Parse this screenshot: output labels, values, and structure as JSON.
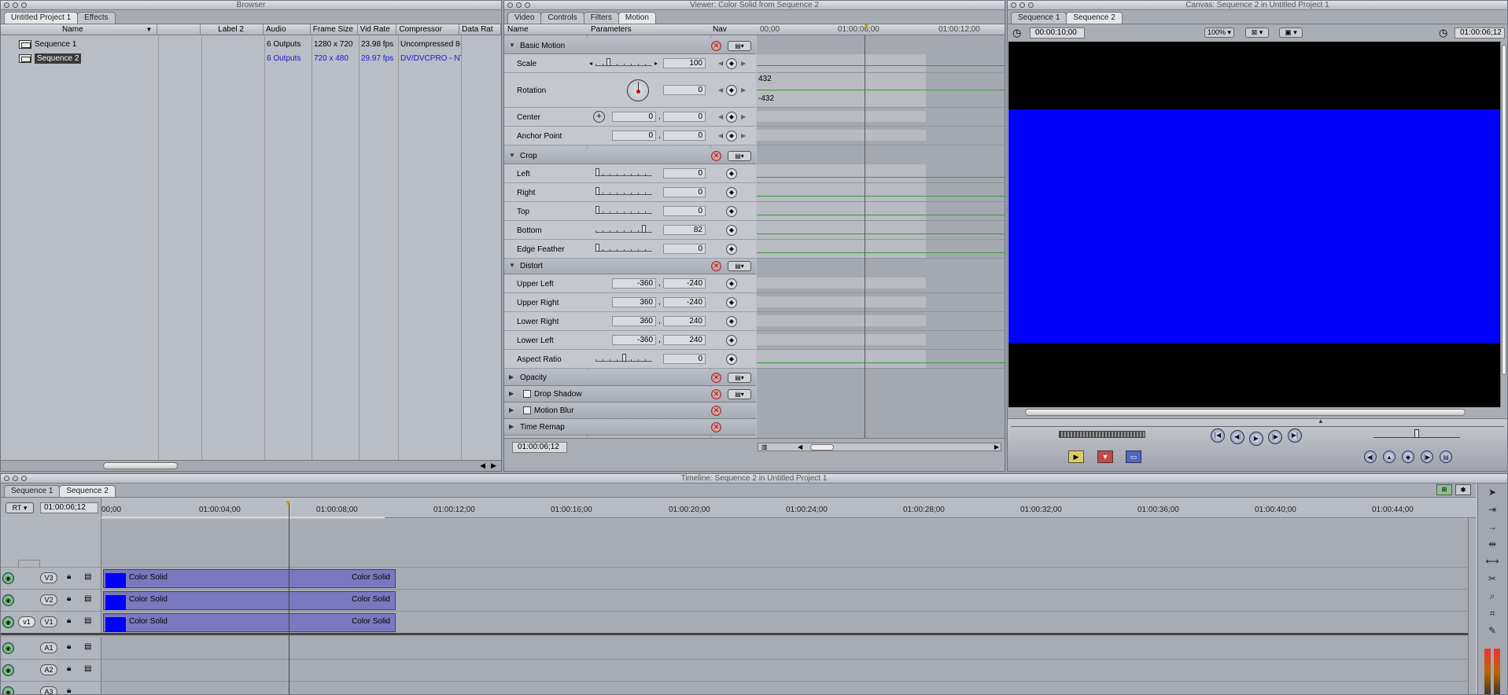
{
  "browser": {
    "title": "Browser",
    "tabs": [
      "Untitled Project 1",
      "Effects"
    ],
    "columns": [
      "Name",
      "Label 2",
      "Audio",
      "Frame Size",
      "Vid Rate",
      "Compressor",
      "Data Rat"
    ],
    "rows": [
      {
        "name": "Sequence 1",
        "audio": "6 Outputs",
        "frame_size": "1280 x 720",
        "vid_rate": "23.98 fps",
        "compressor": "Uncompressed 8-"
      },
      {
        "name": "Sequence 2",
        "audio": "6 Outputs",
        "frame_size": "720 x 480",
        "vid_rate": "29.97 fps",
        "compressor": "DV/DVCPRO - NT"
      }
    ]
  },
  "viewer": {
    "title": "Viewer: Color Solid from Sequence 2",
    "tabs": [
      "Video",
      "Controls",
      "Filters",
      "Motion"
    ],
    "header": {
      "name": "Name",
      "parameters": "Parameters",
      "nav": "Nav"
    },
    "ruler": [
      "00;00",
      "01:00:06;00",
      "01:00:12;00"
    ],
    "rotation_range": [
      "432",
      "-432"
    ],
    "groups": {
      "basic_motion": "Basic Motion",
      "crop": "Crop",
      "distort": "Distort",
      "opacity": "Opacity",
      "drop_shadow": "Drop Shadow",
      "motion_blur": "Motion Blur",
      "time_remap": "Time Remap"
    },
    "params": {
      "scale": {
        "label": "Scale",
        "value": "100"
      },
      "rotation": {
        "label": "Rotation",
        "value": "0"
      },
      "center": {
        "label": "Center",
        "x": "0",
        "y": "0"
      },
      "anchor": {
        "label": "Anchor Point",
        "x": "0",
        "y": "0"
      },
      "left": {
        "label": "Left",
        "value": "0"
      },
      "right": {
        "label": "Right",
        "value": "0"
      },
      "top": {
        "label": "Top",
        "value": "0"
      },
      "bottom": {
        "label": "Bottom",
        "value": "82"
      },
      "edge_feather": {
        "label": "Edge Feather",
        "value": "0"
      },
      "upper_left": {
        "label": "Upper Left",
        "x": "-360",
        "y": "-240"
      },
      "upper_right": {
        "label": "Upper Right",
        "x": "360",
        "y": "-240"
      },
      "lower_right": {
        "label": "Lower Right",
        "x": "360",
        "y": "240"
      },
      "lower_left": {
        "label": "Lower Left",
        "x": "-360",
        "y": "240"
      },
      "aspect_ratio": {
        "label": "Aspect Ratio",
        "value": "0"
      }
    },
    "timecode": "01:00:06;12"
  },
  "canvas": {
    "title": "Canvas: Sequence 2 in Untitled Project 1",
    "tabs": [
      "Sequence 1",
      "Sequence 2"
    ],
    "duration": "00:00:10;00",
    "zoom": "100%",
    "timecode": "01:00:06;12",
    "colors": {
      "frame": "#0000ff",
      "background": "#000000"
    }
  },
  "timeline": {
    "title": "Timeline: Sequence 2 in Untitled Project 1",
    "tabs": [
      "Sequence 1",
      "Sequence 2"
    ],
    "rt": "RT",
    "timecode": "01:00:06;12",
    "ruler": [
      "00;00",
      "01:00:04;00",
      "01:00:08;00",
      "01:00:12;00",
      "01:00:16;00",
      "01:00:20;00",
      "01:00:24;00",
      "01:00:28;00",
      "01:00:32;00",
      "01:00:36;00",
      "01:00:40;00",
      "01:00:44;00"
    ],
    "video_tracks": [
      {
        "name": "V3",
        "clip_left": "Color Solid",
        "clip_right": "Color Solid"
      },
      {
        "name": "V2",
        "clip_left": "Color Solid",
        "clip_right": "Color Solid"
      },
      {
        "name": "V1",
        "src": "v1",
        "clip_left": "Color Solid",
        "clip_right": "Color Solid"
      }
    ],
    "audio_tracks": [
      "A1",
      "A2",
      "A3"
    ]
  }
}
